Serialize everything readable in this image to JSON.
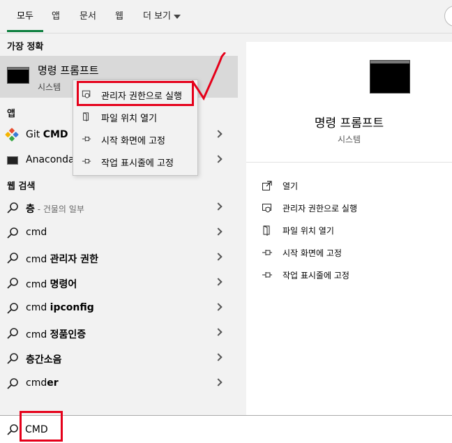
{
  "tabs": [
    {
      "label": "모두"
    },
    {
      "label": "앱"
    },
    {
      "label": "문서"
    },
    {
      "label": "웹"
    },
    {
      "label": "더 보기"
    }
  ],
  "sections": {
    "best_match": "가장 정확",
    "apps": "앱",
    "web": "웹 검색"
  },
  "best_match": {
    "title": "명령 프롬프트",
    "subtitle": "시스템"
  },
  "apps": [
    {
      "pre": "Git ",
      "bold": "CMD"
    },
    {
      "pre": "Anaconda",
      "bold": ""
    }
  ],
  "web_results": [
    {
      "pre": "",
      "bold": "층",
      "muted": " - 건물의 일부"
    },
    {
      "pre": "cmd",
      "bold": "",
      "muted": ""
    },
    {
      "pre": "cmd ",
      "bold": "관리자 권한",
      "muted": ""
    },
    {
      "pre": "cmd ",
      "bold": "명령어",
      "muted": ""
    },
    {
      "pre": "cmd ",
      "bold": "ipconfig",
      "muted": ""
    },
    {
      "pre": "cmd ",
      "bold": "정품인증",
      "muted": ""
    },
    {
      "pre": "",
      "bold": "층간소음",
      "muted": ""
    },
    {
      "pre": "cmd",
      "bold": "er",
      "muted": ""
    }
  ],
  "context_menu": [
    {
      "label": "관리자 권한으로 실행",
      "icon": "shield-icon"
    },
    {
      "label": "파일 위치 열기",
      "icon": "file-location-icon"
    },
    {
      "label": "시작 화면에 고정",
      "icon": "pin-icon"
    },
    {
      "label": "작업 표시줄에 고정",
      "icon": "pin-icon"
    }
  ],
  "preview": {
    "title": "명령 프롬프트",
    "subtitle": "시스템",
    "actions": [
      {
        "label": "열기",
        "icon": "open-icon"
      },
      {
        "label": "관리자 권한으로 실행",
        "icon": "shield-icon"
      },
      {
        "label": "파일 위치 열기",
        "icon": "file-location-icon"
      },
      {
        "label": "시작 화면에 고정",
        "icon": "pin-icon"
      },
      {
        "label": "작업 표시줄에 고정",
        "icon": "pin-icon"
      }
    ]
  },
  "search": {
    "query": "CMD"
  },
  "colors": {
    "accent": "#0a7d3c",
    "annotation": "#e5001a",
    "selected_bg": "#d9d9d9"
  }
}
